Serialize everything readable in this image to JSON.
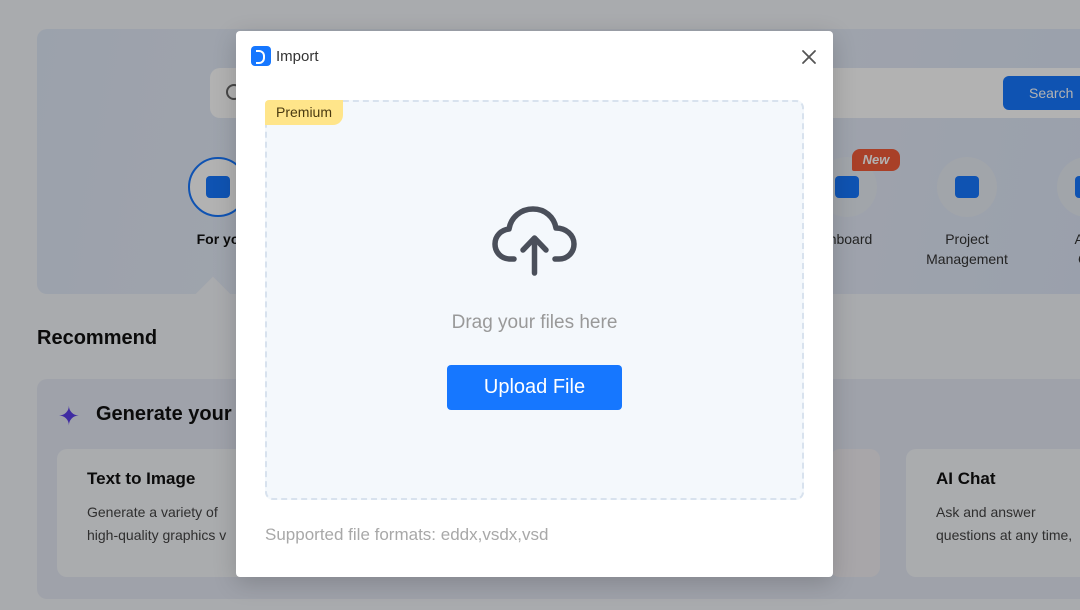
{
  "background": {
    "search_button": "Search",
    "categories": [
      {
        "label": "For you",
        "visible": "For yo"
      },
      {
        "label": "Dashboard",
        "visible": "shboard",
        "badge": "New"
      },
      {
        "label": "Project Management",
        "line1": "Project",
        "line2": "Management"
      },
      {
        "label": "Analysis Ca",
        "line1": "Ana",
        "line2": "Ca"
      }
    ],
    "recommend_title": "Recommend",
    "generate_title": "Generate your",
    "cards": [
      {
        "title": "Text to Image",
        "desc_line1": "Generate a variety of",
        "desc_line2": "high-quality graphics v"
      },
      {
        "title": "AI Chat",
        "desc_line1": "Ask and answer",
        "desc_line2": "questions at any time,"
      }
    ]
  },
  "dialog": {
    "title": "Import",
    "premium_badge": "Premium",
    "drag_text": "Drag your files here",
    "upload_button": "Upload File",
    "supported_formats": "Supported file formats: eddx,vsdx,vsd"
  },
  "colors": {
    "accent": "#1677ff",
    "premium": "#ffe58a",
    "new_badge": "#f25c3a",
    "overlay": "rgba(0,0,0,0.3)"
  }
}
